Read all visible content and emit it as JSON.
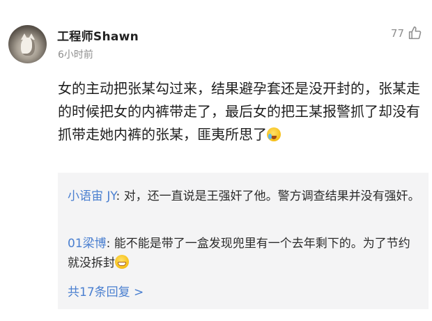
{
  "comment": {
    "username": "工程师Shawn",
    "time": "6小时前",
    "like_count": "77",
    "content_text": "女的主动把张某勾过来，结果避孕套还是没开封的，张某走的时候把女的内裤带走了，最后女的把王某报警抓了却没有抓带走她内裤的张某，匪夷所思了",
    "content_emoji": "crying-laughing-emoji",
    "avatar_icon": "cat-avatar"
  },
  "replies": [
    {
      "name": "小语宙 JY",
      "text": "对，还一直说是王强奸了他。警方调查结果并没有强奸。"
    },
    {
      "name": "01梁博",
      "text": "能不能是带了一盒发现兜里有一个去年剩下的。为了节约就没拆封",
      "emoji": "grinning-emoji"
    }
  ],
  "more_replies": "共17条回复 >",
  "colors": {
    "link_blue": "#4a7fd0",
    "meta_gray": "#8e8e8e",
    "reply_bg": "#f4f4f5"
  }
}
